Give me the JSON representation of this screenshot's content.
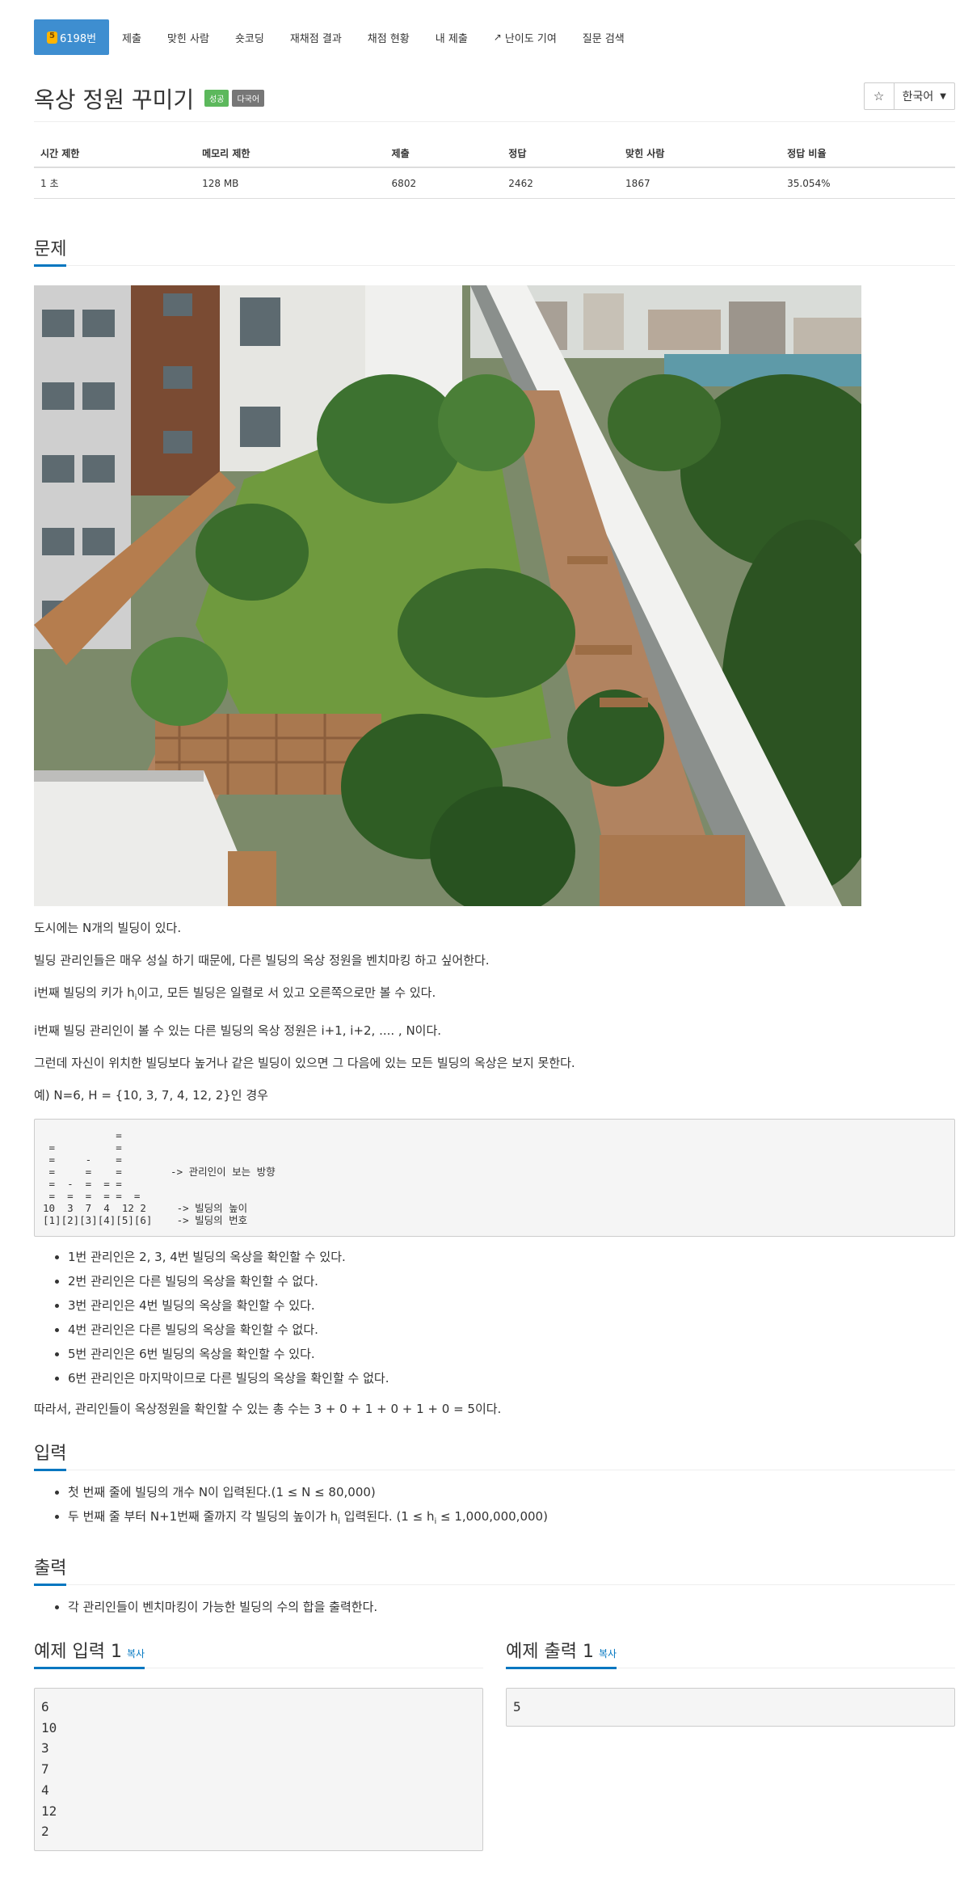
{
  "tabs": [
    {
      "label": "6198번",
      "active": true
    },
    {
      "label": "제출"
    },
    {
      "label": "맞힌 사람"
    },
    {
      "label": "숏코딩"
    },
    {
      "label": "재채점 결과"
    },
    {
      "label": "채점 현황"
    },
    {
      "label": "내 제출"
    },
    {
      "label": "난이도 기여"
    },
    {
      "label": "질문 검색"
    }
  ],
  "title": "옥상 정원 꾸미기",
  "badges": {
    "success": "성공",
    "multilang": "다국어"
  },
  "language": "한국어",
  "stats": {
    "headers": [
      "시간 제한",
      "메모리 제한",
      "제출",
      "정답",
      "맞힌 사람",
      "정답 비율"
    ],
    "values": [
      "1 초",
      "128 MB",
      "6802",
      "2462",
      "1867",
      "35.054%"
    ]
  },
  "sections": {
    "problem": "문제",
    "input": "입력",
    "output": "출력"
  },
  "problem": {
    "p1": "도시에는 N개의 빌딩이 있다.",
    "p2": "빌딩 관리인들은 매우 성실 하기 때문에, 다른 빌딩의 옥상 정원을 벤치마킹 하고 싶어한다.",
    "p3_a": "i번째 빌딩의 키가 h",
    "p3_sub": "i",
    "p3_b": "이고, 모든 빌딩은 일렬로 서 있고 오른쪽으로만 볼 수 있다.",
    "p4": "i번째 빌딩 관리인이 볼 수 있는 다른 빌딩의 옥상 정원은 i+1, i+2, .... , N이다.",
    "p5": "그런데 자신이 위치한 빌딩보다 높거나 같은 빌딩이 있으면 그 다음에 있는 모든 빌딩의 옥상은 보지 못한다.",
    "p6": "예) N=6, H = {10, 3, 7, 4, 12, 2}인 경우",
    "diagram": "            =\n =          =\n =     -    =\n =     =    =        -> 관리인이 보는 방향\n =  -  =  = =\n =  =  =  = =  =\n10  3  7  4  12 2     -> 빌딩의 높이\n[1][2][3][4][5][6]    -> 빌딩의 번호",
    "bullets": [
      "1번 관리인은 2, 3, 4번 빌딩의 옥상을 확인할 수 있다.",
      "2번 관리인은 다른 빌딩의 옥상을 확인할 수 없다.",
      "3번 관리인은 4번 빌딩의 옥상을 확인할 수 있다.",
      "4번 관리인은 다른 빌딩의 옥상을 확인할 수 없다.",
      "5번 관리인은 6번 빌딩의 옥상을 확인할 수 있다.",
      "6번 관리인은 마지막이므로 다른 빌딩의 옥상을 확인할 수 없다."
    ],
    "conclusion": "따라서, 관리인들이 옥상정원을 확인할 수 있는 총 수는 3 + 0 + 1 + 0 + 1 + 0 = 5이다."
  },
  "input": {
    "b1": "첫 번째 줄에 빌딩의 개수 N이 입력된다.(1 ≤ N ≤ 80,000)",
    "b2_a": "두 번째 줄 부터 N+1번째 줄까지 각 빌딩의 높이가 h",
    "b2_sub": "i",
    "b2_b": " 입력된다. (1 ≤ h",
    "b2_sub2": "i",
    "b2_c": " ≤ 1,000,000,000)"
  },
  "output": {
    "b1": "각 관리인들이 벤치마킹이 가능한 빌딩의 수의 합을 출력한다."
  },
  "samples": {
    "input_title": "예제 입력 1",
    "output_title": "예제 출력 1",
    "copy": "복사",
    "input_text": "6\n10\n3\n7\n4\n12\n2",
    "output_text": "5"
  }
}
